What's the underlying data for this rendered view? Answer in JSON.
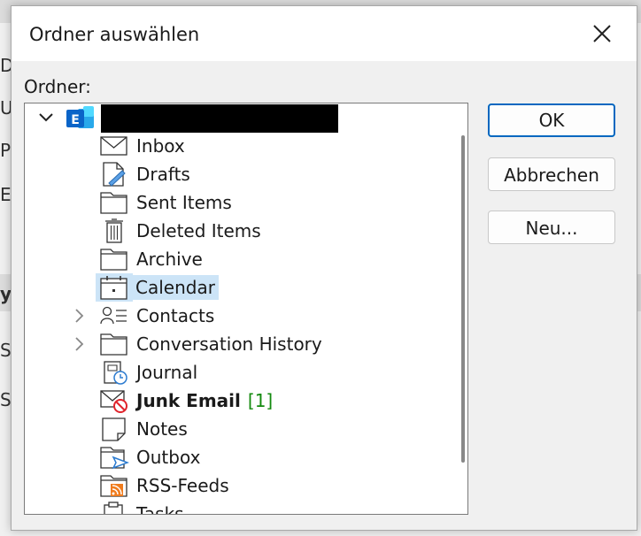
{
  "background": {
    "letters": [
      "Da",
      "Us",
      "Pa",
      "Er",
      "y",
      "Sy",
      "Sy"
    ]
  },
  "dialog": {
    "title": "Ordner auswählen",
    "folder_label": "Ordner:",
    "buttons": {
      "ok": "OK",
      "cancel": "Abbrechen",
      "new": "Neu..."
    }
  },
  "tree": {
    "items": [
      {
        "label": "Inbox",
        "icon": "envelope-icon"
      },
      {
        "label": "Drafts",
        "icon": "draft-icon"
      },
      {
        "label": "Sent Items",
        "icon": "folder-icon"
      },
      {
        "label": "Deleted Items",
        "icon": "trash-icon"
      },
      {
        "label": "Archive",
        "icon": "folder-icon"
      },
      {
        "label": "Calendar",
        "icon": "calendar-icon",
        "selected": true
      },
      {
        "label": "Contacts",
        "icon": "contacts-icon",
        "expandable": true
      },
      {
        "label": "Conversation History",
        "icon": "folder-icon",
        "expandable": true
      },
      {
        "label": "Journal",
        "icon": "journal-icon"
      },
      {
        "label": "Junk Email",
        "icon": "junk-icon",
        "count": "[1]",
        "bold": true
      },
      {
        "label": "Notes",
        "icon": "note-icon"
      },
      {
        "label": "Outbox",
        "icon": "outbox-icon"
      },
      {
        "label": "RSS-Feeds",
        "icon": "rss-icon"
      },
      {
        "label": "Tasks",
        "icon": "tasks-icon"
      }
    ]
  },
  "colors": {
    "selection": "#cce4f7",
    "accent": "#0067c0",
    "exchange_blue": "#0a64c8",
    "unread_count": "#138a0e",
    "rss_orange": "#f07c1e",
    "junk_red": "#e0242c"
  }
}
